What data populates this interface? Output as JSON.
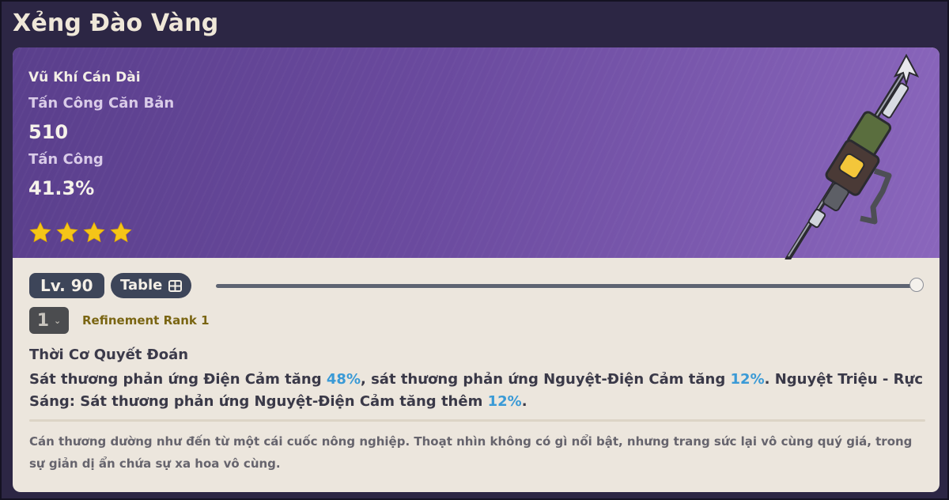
{
  "title": "Xẻng Đào Vàng",
  "weapon": {
    "type": "Vũ Khí Cán Dài",
    "base_atk_label": "Tấn Công Căn Bản",
    "base_atk_value": "510",
    "substat_label": "Tấn Công",
    "substat_value": "41.3%",
    "rarity_stars": 4,
    "image_icon": "polearm-weapon-image"
  },
  "controls": {
    "level_label": "Lv. 90",
    "table_label": "Table",
    "table_icon": "table-grid-icon",
    "level_slider_value": 1.0,
    "refinement_value": "1",
    "refinement_label": "Refinement Rank 1"
  },
  "passive": {
    "name": "Thời Cơ Quyết Đoán",
    "desc_part1": "Sát thương phản ứng Điện Cảm tăng ",
    "desc_hl1": "48%",
    "desc_part2": ", sát thương phản ứng Nguyệt-Điện Cảm tăng ",
    "desc_hl2": "12%",
    "desc_part3": ". Nguyệt Triệu - Rực Sáng: Sát thương phản ứng Nguyệt-Điện Cảm tăng thêm ",
    "desc_hl3": "12%",
    "desc_part4": "."
  },
  "lore": "Cán thương dường như đến từ một cái cuốc nông nghiệp. Thoạt nhìn không có gì nổi bật, nhưng trang sức lại vô cùng quý giá, trong sự giản dị ẩn chứa sự xa hoa vô cùng.",
  "colors": {
    "highlight": "#3a9ad6",
    "star": "#f5c518",
    "hero_start": "#5a3f8c",
    "hero_end": "#8a66bc",
    "refine_text": "#7a6512"
  }
}
